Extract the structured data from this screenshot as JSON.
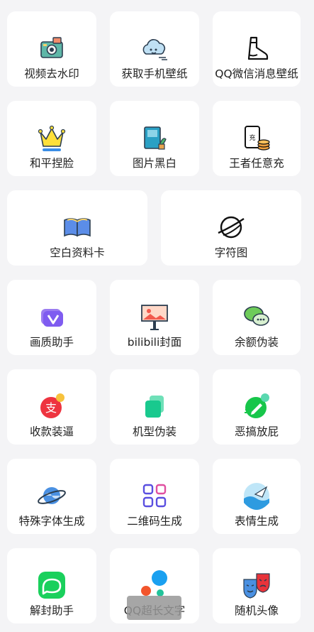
{
  "tools": [
    {
      "label": "视频去水印",
      "icon": "camera-icon"
    },
    {
      "label": "获取手机壁纸",
      "icon": "cloud-icon"
    },
    {
      "label": "QQ微信消息壁纸",
      "icon": "boot-icon"
    },
    {
      "label": "和平捏脸",
      "icon": "crown-icon"
    },
    {
      "label": "图片黑白",
      "icon": "book-plant-icon"
    },
    {
      "label": "王者任意充",
      "icon": "recharge-coins-icon"
    },
    {
      "label": "空白资料卡",
      "icon": "open-book-icon"
    },
    {
      "label": "字符图",
      "icon": "planet-icon"
    },
    {
      "label": "画质助手",
      "icon": "quality-v-icon"
    },
    {
      "label": "bilibili封面",
      "icon": "billboard-icon"
    },
    {
      "label": "余额伪装",
      "icon": "chat-bubbles-icon"
    },
    {
      "label": "收款装逼",
      "icon": "alipay-icon"
    },
    {
      "label": "机型伪装",
      "icon": "phone-layers-icon"
    },
    {
      "label": "恶搞放屁",
      "icon": "pencil-circle-icon"
    },
    {
      "label": "特殊字体生成",
      "icon": "saturn-icon"
    },
    {
      "label": "二维码生成",
      "icon": "qr-code-icon"
    },
    {
      "label": "表情生成",
      "icon": "sea-paper-plane-icon"
    },
    {
      "label": "解封助手",
      "icon": "message-icon"
    },
    {
      "label": "QQ超长文字",
      "icon": "dots-icon"
    },
    {
      "label": "随机头像",
      "icon": "drama-masks-icon"
    }
  ],
  "toast": {
    "text": ""
  },
  "colors": {
    "background": "#f4f4f6",
    "card": "#ffffff",
    "text": "#222222"
  }
}
